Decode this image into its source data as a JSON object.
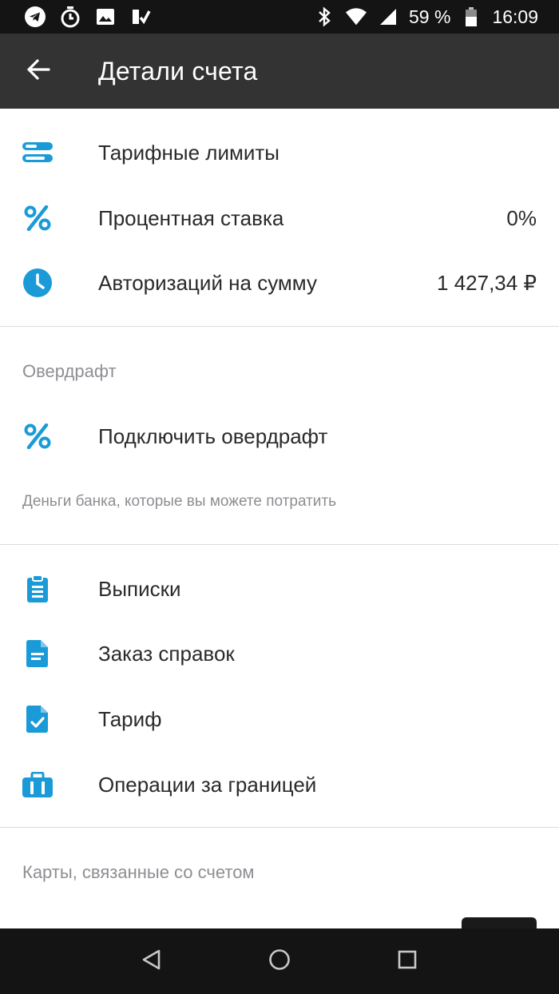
{
  "status_bar": {
    "battery": "59 %",
    "time": "16:09"
  },
  "app_bar": {
    "title": "Детали счета"
  },
  "account_rows": [
    {
      "label": "Тарифные лимиты",
      "value": "",
      "icon": "limits-icon"
    },
    {
      "label": "Процентная ставка",
      "value": "0%",
      "icon": "percent-icon"
    },
    {
      "label": "Авторизаций на сумму",
      "value": "1 427,34 ₽",
      "icon": "clock-icon"
    }
  ],
  "overdraft": {
    "section_title": "Овердрафт",
    "item_label": "Подключить овердрафт",
    "hint": "Деньги банка, которые вы можете потратить"
  },
  "documents": [
    {
      "label": "Выписки",
      "icon": "clipboard-icon"
    },
    {
      "label": "Заказ справок",
      "icon": "document-icon"
    },
    {
      "label": "Тариф",
      "icon": "document-check-icon"
    },
    {
      "label": "Операции за границей",
      "icon": "suitcase-icon"
    }
  ],
  "cards_section": {
    "title": "Карты, связанные со счетом"
  },
  "colors": {
    "accent": "#1a9bd7",
    "status_bar": "#141414",
    "app_bar": "#333333"
  }
}
